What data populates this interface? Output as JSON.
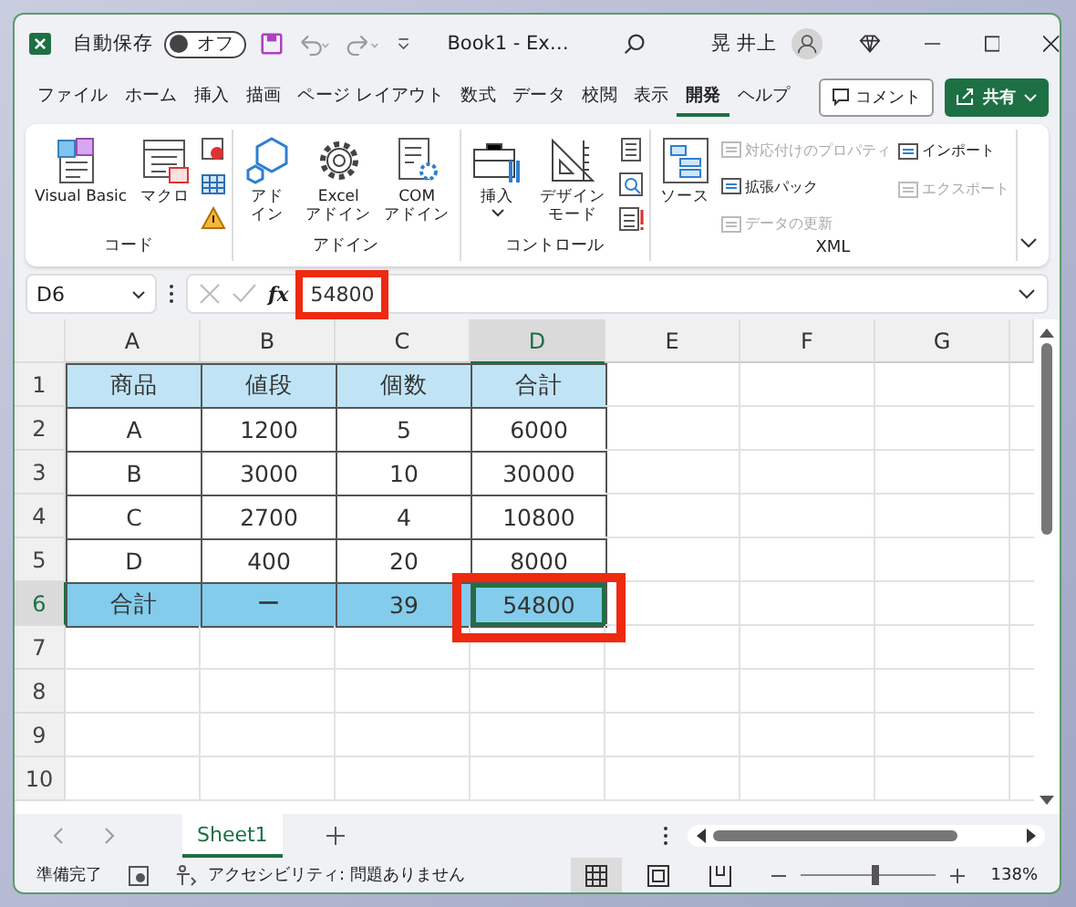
{
  "title_bar": {
    "autosave_label": "自動保存",
    "autosave": {
      "on": false,
      "label": "オフ"
    },
    "title": "Book1 - Ex…",
    "user": "晃 井上"
  },
  "tabs": [
    {
      "label": "ファイル",
      "selected": false
    },
    {
      "label": "ホーム",
      "selected": false
    },
    {
      "label": "挿入",
      "selected": false
    },
    {
      "label": "描画",
      "selected": false
    },
    {
      "label": "ページ レイアウト",
      "selected": false
    },
    {
      "label": "数式",
      "selected": false
    },
    {
      "label": "データ",
      "selected": false
    },
    {
      "label": "校閲",
      "selected": false
    },
    {
      "label": "表示",
      "selected": false
    },
    {
      "label": "開発",
      "selected": true
    },
    {
      "label": "ヘルプ",
      "selected": false
    }
  ],
  "comment_button": "コメント",
  "share_button": "共有",
  "ribbon_groups": [
    {
      "label": "コード",
      "items": [
        {
          "kind": "large",
          "label": "Visual Basic"
        },
        {
          "kind": "large",
          "label": "マクロ"
        },
        {
          "kind": "column"
        }
      ]
    },
    {
      "label": "アドイン",
      "items": [
        {
          "kind": "large",
          "label": "アドイン"
        },
        {
          "kind": "large",
          "label": "Excel\nアドイン"
        },
        {
          "kind": "large",
          "label": "COM\nアドイン"
        }
      ]
    },
    {
      "label": "コントロール",
      "items": [
        {
          "kind": "large",
          "label": "挿入",
          "dropdown": true
        },
        {
          "kind": "large",
          "label": "デザインモード"
        },
        {
          "kind": "column"
        }
      ]
    },
    {
      "label": "XML",
      "items": [
        {
          "kind": "large",
          "label": "ソース"
        },
        {
          "kind": "small",
          "rows": [
            {
              "label": "対応付けのプロパティ",
              "disabled": true
            },
            {
              "label": "拡張パック",
              "disabled": false
            },
            {
              "label": "データの更新",
              "disabled": true
            }
          ]
        },
        {
          "kind": "small",
          "rows": [
            {
              "label": "インポート",
              "disabled": false
            },
            {
              "label": "エクスポート",
              "disabled": true
            }
          ]
        }
      ]
    }
  ],
  "formula_bar": {
    "name_box": "D6",
    "fx": "fx",
    "value": "54800",
    "highlighted": true
  },
  "sheet": {
    "columns": [
      {
        "label": "A",
        "selected": false
      },
      {
        "label": "B",
        "selected": false
      },
      {
        "label": "C",
        "selected": false
      },
      {
        "label": "D",
        "selected": true
      },
      {
        "label": "E",
        "selected": false
      },
      {
        "label": "F",
        "selected": false
      },
      {
        "label": "G",
        "selected": false
      }
    ],
    "rows": [
      {
        "number": "1",
        "kind": "header",
        "selected": false,
        "cells": [
          "商品",
          "値段",
          "個数",
          "合計"
        ]
      },
      {
        "number": "2",
        "kind": "body",
        "selected": false,
        "cells": [
          "A",
          "1200",
          "5",
          "6000"
        ]
      },
      {
        "number": "3",
        "kind": "body",
        "selected": false,
        "cells": [
          "B",
          "3000",
          "10",
          "30000"
        ]
      },
      {
        "number": "4",
        "kind": "body",
        "selected": false,
        "cells": [
          "C",
          "2700",
          "4",
          "10800"
        ]
      },
      {
        "number": "5",
        "kind": "body",
        "selected": false,
        "cells": [
          "D",
          "400",
          "20",
          "8000"
        ]
      },
      {
        "number": "6",
        "kind": "total",
        "selected": true,
        "cells": [
          "合計",
          "ー",
          "39",
          "54800"
        ]
      },
      {
        "number": "7",
        "selected": false
      },
      {
        "number": "8",
        "selected": false
      },
      {
        "number": "9",
        "selected": false
      },
      {
        "number": "10",
        "selected": false
      }
    ],
    "selection_highlighted": true
  },
  "sheet_tabs": [
    {
      "label": "Sheet1",
      "selected": true
    }
  ],
  "status_bar": {
    "status": "準備完了",
    "accessibility": "アクセシビリティ: 問題ありません",
    "view_modes": [
      {
        "kind": "normal",
        "selected": true
      },
      {
        "kind": "layout",
        "selected": false
      },
      {
        "kind": "break",
        "selected": false
      }
    ],
    "zoom": {
      "level": 0.55,
      "label": "138%"
    }
  }
}
